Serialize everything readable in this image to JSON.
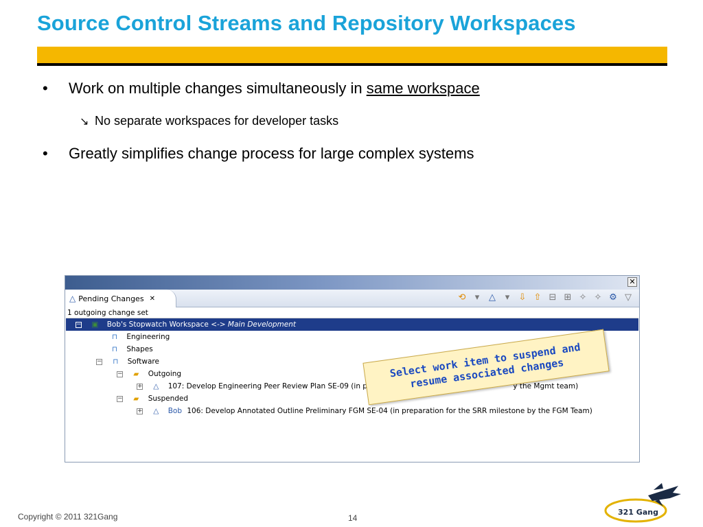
{
  "slide": {
    "title": "Source Control Streams and Repository Workspaces",
    "bullets": [
      {
        "prefix": "Work on multiple changes simultaneously in ",
        "link": "same workspace"
      },
      {
        "text": "Greatly simplifies change process for large complex systems"
      }
    ],
    "sub_bullet": "No separate workspaces for developer tasks",
    "bullet_symbol": "•",
    "sub_symbol": "↘"
  },
  "window": {
    "close_symbol": "✕",
    "tab_label": "Pending Changes",
    "tab_close": "✕",
    "status": "1 outgoing change set",
    "tree": [
      {
        "label": "Bob's Stopwatch Workspace",
        "suffix": "<-> Main Development"
      },
      {
        "label": "Engineering"
      },
      {
        "label": "Shapes"
      },
      {
        "label": "Software"
      },
      {
        "label": "Outgoing"
      },
      {
        "label": "107: Develop Engineering Peer Review Plan SE-09 (in pr",
        "tail": "y the Mgmt team)"
      },
      {
        "label": "Suspended"
      },
      {
        "prefix": "Bob",
        "label": "106: Develop Annotated Outline Preliminary  FGM SE-04 (in preparation for the SRR milestone by the FGM Team)"
      }
    ]
  },
  "callout": {
    "line1": "Select work item to suspend and",
    "line2": "resume associated changes"
  },
  "footer": {
    "copyright": "Copyright © 2011 321Gang",
    "page": "14"
  },
  "logo": {
    "text": "321 Gang"
  },
  "colors": {
    "title": "#1aa3d9",
    "accent_bar": "#f5b700",
    "selection": "#1e3c8a",
    "callout_text": "#1a49c0"
  }
}
